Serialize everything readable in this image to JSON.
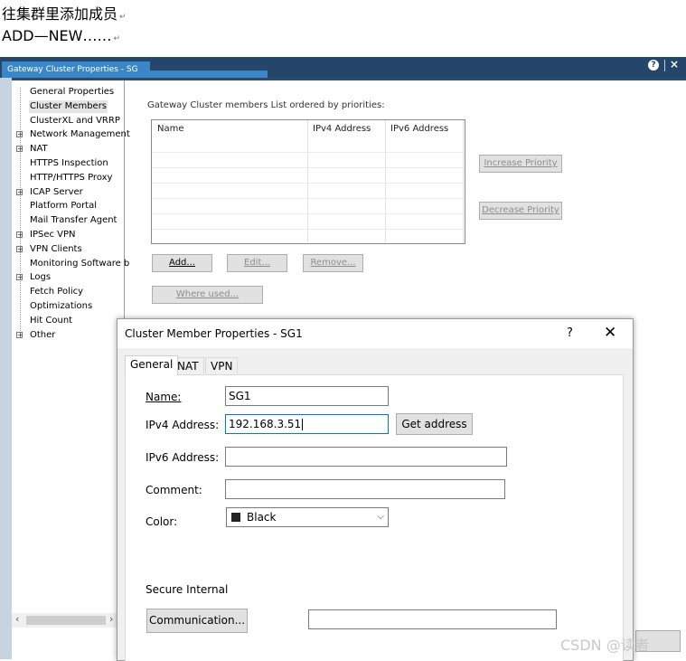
{
  "doc": {
    "line1": "往集群里添加成员",
    "line2": "ADD—NEW……"
  },
  "outer_window": {
    "title": "Gateway Cluster Properties - SG",
    "help_icon": "?",
    "close_icon": "×"
  },
  "tree": {
    "items": [
      {
        "label": "General Properties",
        "expandable": false,
        "selected": false
      },
      {
        "label": "Cluster Members",
        "expandable": false,
        "selected": true
      },
      {
        "label": "ClusterXL and VRRP",
        "expandable": false,
        "selected": false
      },
      {
        "label": "Network Management",
        "expandable": true,
        "selected": false
      },
      {
        "label": "NAT",
        "expandable": true,
        "selected": false
      },
      {
        "label": "HTTPS Inspection",
        "expandable": false,
        "selected": false
      },
      {
        "label": "HTTP/HTTPS Proxy",
        "expandable": false,
        "selected": false
      },
      {
        "label": "ICAP Server",
        "expandable": true,
        "selected": false
      },
      {
        "label": "Platform Portal",
        "expandable": false,
        "selected": false
      },
      {
        "label": "Mail Transfer Agent",
        "expandable": false,
        "selected": false
      },
      {
        "label": "IPSec VPN",
        "expandable": true,
        "selected": false
      },
      {
        "label": "VPN Clients",
        "expandable": true,
        "selected": false
      },
      {
        "label": "Monitoring Software b",
        "expandable": false,
        "selected": false
      },
      {
        "label": "Logs",
        "expandable": true,
        "selected": false
      },
      {
        "label": "Fetch Policy",
        "expandable": false,
        "selected": false
      },
      {
        "label": "Optimizations",
        "expandable": false,
        "selected": false
      },
      {
        "label": "Hit Count",
        "expandable": false,
        "selected": false
      },
      {
        "label": "Other",
        "expandable": true,
        "selected": false
      }
    ]
  },
  "members": {
    "title": "Gateway Cluster members List ordered by priorities:",
    "columns": [
      "Name",
      "IPv4 Address",
      "IPv6 Address"
    ],
    "rows": [],
    "buttons": {
      "add": "Add...",
      "edit": "Edit...",
      "remove": "Remove...",
      "where_used": "Where used...",
      "increase_priority": "Increase Priority",
      "decrease_priority": "Decrease Priority"
    }
  },
  "dialog": {
    "title": "Cluster Member Properties - SG1",
    "help": "?",
    "close": "✕",
    "tabs": [
      "General",
      "NAT",
      "VPN"
    ],
    "active_tab": "General",
    "fields": {
      "name_label": "Name:",
      "name_value": "SG1",
      "ipv4_label": "IPv4 Address:",
      "ipv4_value": "192.168.3.51",
      "get_address": "Get address",
      "ipv6_label": "IPv6 Address:",
      "ipv6_value": "",
      "comment_label": "Comment:",
      "comment_value": "",
      "color_label": "Color:",
      "color_value": "Black",
      "secure_internal": "Secure Internal",
      "communication": "Communication...",
      "communication_value": ""
    }
  },
  "watermark": "CSDN @读者",
  "colors": {
    "title_bar": "#24466b",
    "title_tab": "#3b86c6",
    "focus_border": "#0078d7"
  }
}
